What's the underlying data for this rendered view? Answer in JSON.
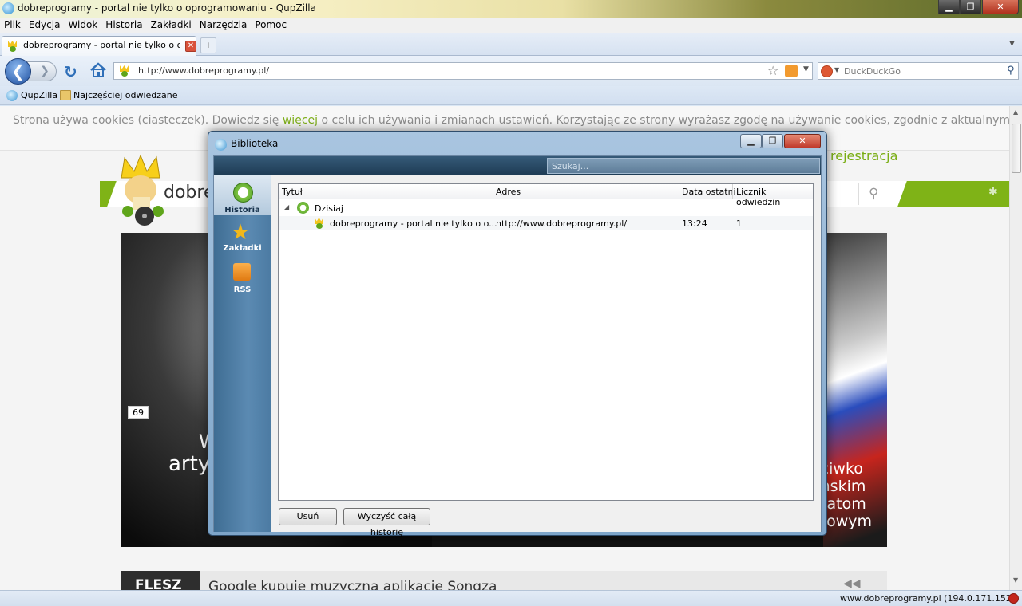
{
  "window": {
    "title": "dobreprogramy - portal nie tylko o oprogramowaniu - QupZilla"
  },
  "menu": [
    "Plik",
    "Edycja",
    "Widok",
    "Historia",
    "Zakładki",
    "Narzędzia",
    "Pomoc"
  ],
  "tab": {
    "label": "dobreprogramy - portal nie tylko o opro..."
  },
  "nav": {
    "url": "http://www.dobreprogramy.pl/",
    "search_placeholder": "DuckDuckGo"
  },
  "bookmarks": [
    {
      "label": "QupZilla"
    },
    {
      "label": "Najczęściej odwiedzane"
    }
  ],
  "page": {
    "cookie_pre": "Strona używa cookies (ciasteczek). Dowiedz się ",
    "cookie_link": "więcej",
    "cookie_post": " o celu ich używania i zmianach ustawień. Korzystając ze strony wyrażasz zgodę na używanie cookies, zgodnie z aktualnymi ustawieniami",
    "register": "rejestracja",
    "logo_text": "dobre",
    "hero_text": "arty",
    "hero_text_w": "W",
    "hero_right": [
      "eciwko",
      "ańskim",
      "ntatom",
      "etowym"
    ],
    "comment_count": "69",
    "flesz_label": "FLESZ",
    "flesz_headline": "Google kupuje muzyczną aplikację Songza"
  },
  "status": {
    "text": "www.dobreprogramy.pl (194.0.171.152)"
  },
  "library": {
    "title": "Biblioteka",
    "search_placeholder": "Szukaj...",
    "sidebar": [
      {
        "label": "Historia"
      },
      {
        "label": "Zakładki"
      },
      {
        "label": "RSS"
      }
    ],
    "columns": [
      "Tytuł",
      "Adres",
      "Data ostatni",
      "Licznik odwiedzin"
    ],
    "group": "Dzisiaj",
    "rows": [
      {
        "title": "dobreprogramy - portal nie tylko o o...",
        "address": "http://www.dobreprogramy.pl/",
        "date": "13:24",
        "count": "1"
      }
    ],
    "btn_delete": "Usuń",
    "btn_clear": "Wyczyść całą historię"
  },
  "colors": {
    "accent_green": "#7fb317",
    "close_red": "#c0392b"
  }
}
